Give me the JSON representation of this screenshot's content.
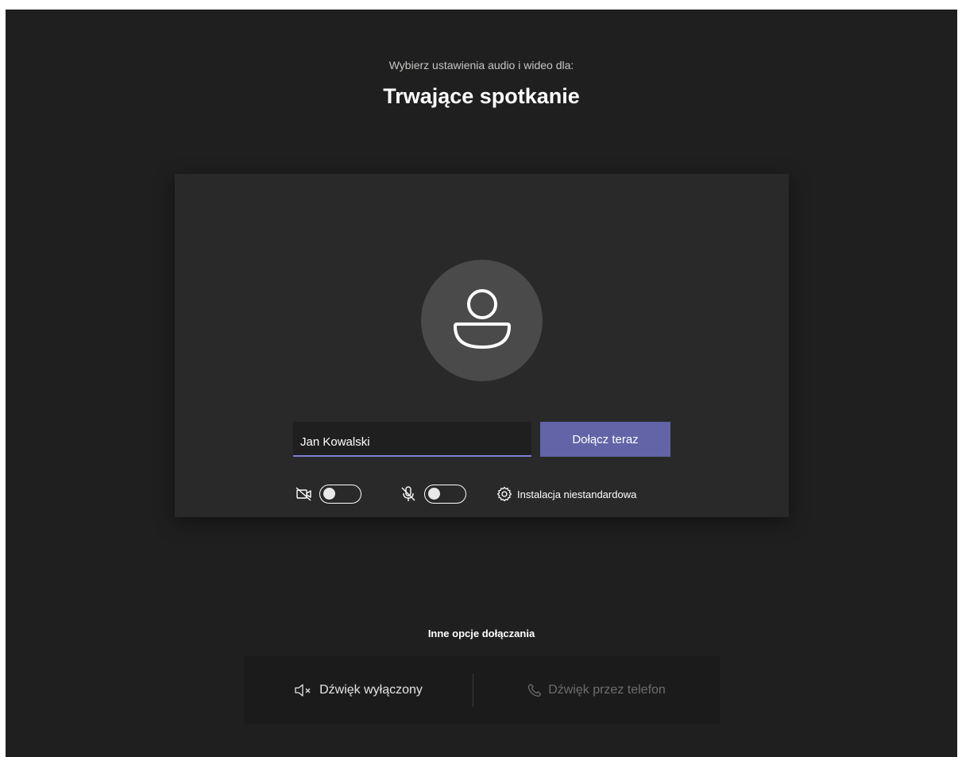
{
  "header": {
    "subtitle": "Wybierz ustawienia audio i wideo dla:",
    "title": "Trwające spotkanie"
  },
  "preview": {
    "avatar_icon": "person-icon",
    "name_input_value": "Jan Kowalski",
    "join_button_label": "Dołącz teraz",
    "camera_toggle": {
      "icon": "video-off-icon",
      "state": "off"
    },
    "mic_toggle": {
      "icon": "mic-off-icon",
      "state": "off"
    },
    "custom_setup": {
      "icon": "gear-icon",
      "label": "Instalacja niestandardowa"
    }
  },
  "other_options": {
    "title": "Inne opcje dołączania",
    "audio_off": {
      "icon": "speaker-mute-icon",
      "label": "Dźwięk wyłączony"
    },
    "phone_audio": {
      "icon": "phone-icon",
      "label": "Dźwięk przez telefon",
      "enabled": false
    }
  },
  "colors": {
    "background": "#1f1f1f",
    "card": "#292929",
    "accent": "#6264a7",
    "input_underline": "#7b7fd4"
  }
}
